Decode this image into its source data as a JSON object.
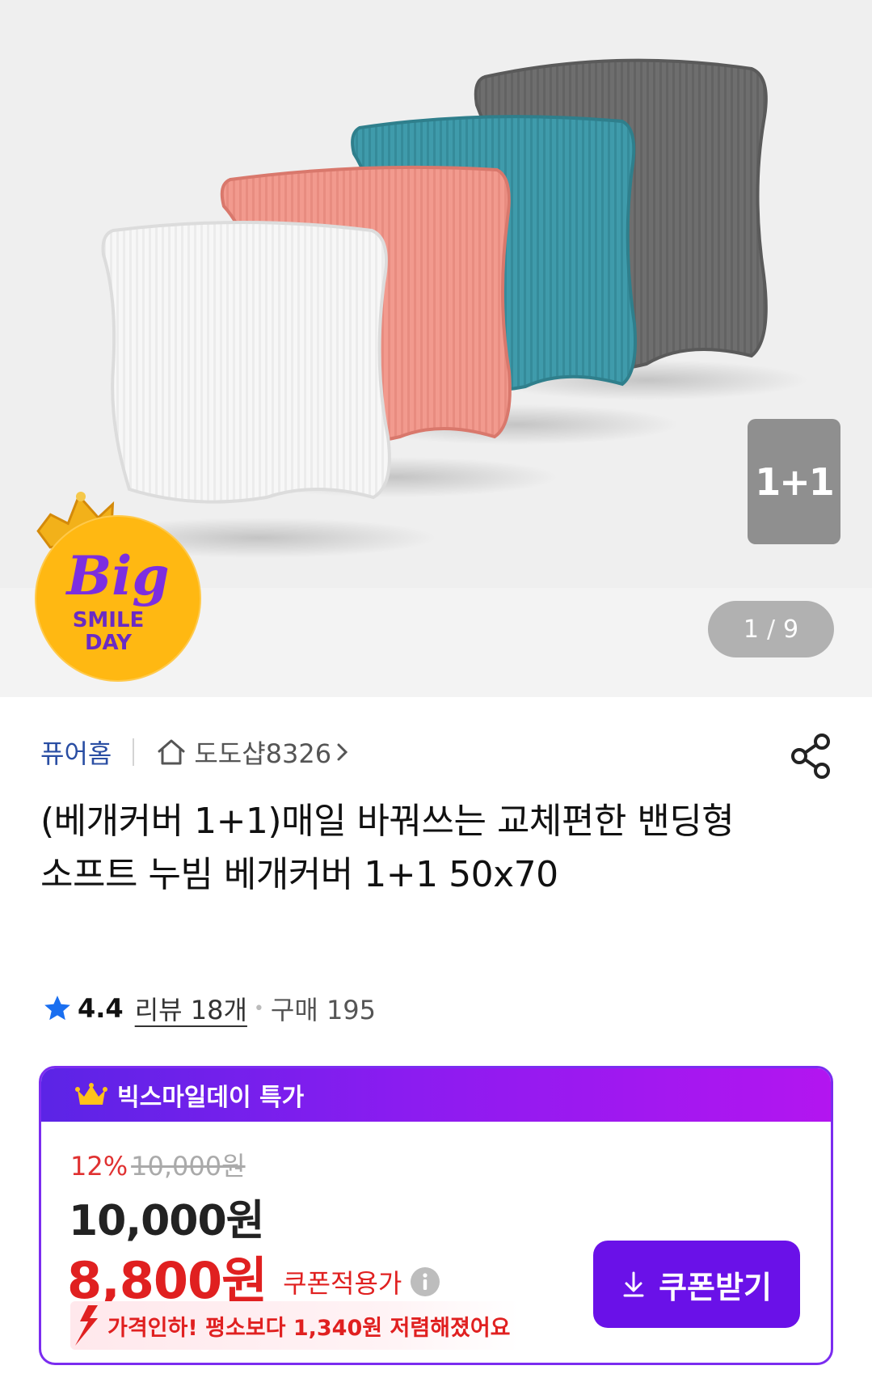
{
  "hero": {
    "badge_text": "1+1",
    "counter_current": "1",
    "counter_separator": "/",
    "counter_total": "9",
    "event_badge": {
      "big": "Big",
      "line1": "SMILE",
      "line2": "DAY"
    }
  },
  "store": {
    "brand": "퓨어홈",
    "shop_name": "도도샵8326"
  },
  "product": {
    "title": "(베개커버 1+1)매일 바꿔쓰는 교체편한 밴딩형 소프트 누빔 베개커버 1+1 50x70",
    "rating": "4.4",
    "review_label": "리뷰 18개",
    "purchase_label": "구매 195"
  },
  "promo": {
    "header": "빅스마일데이 특가",
    "discount_rate": "12%",
    "original_price": "10,000원",
    "base_price": "10,000원",
    "coupon_price": "8,800원",
    "coupon_label": "쿠폰적용가",
    "price_drop_text": "가격인하! 평소보다 1,340원 저렴해졌어요",
    "coupon_button": "쿠폰받기"
  },
  "colors": {
    "brand_blue": "#2a4ea3",
    "accent_purple": "#6a11e8",
    "price_red": "#e02020",
    "star_blue": "#1a6ff0"
  }
}
